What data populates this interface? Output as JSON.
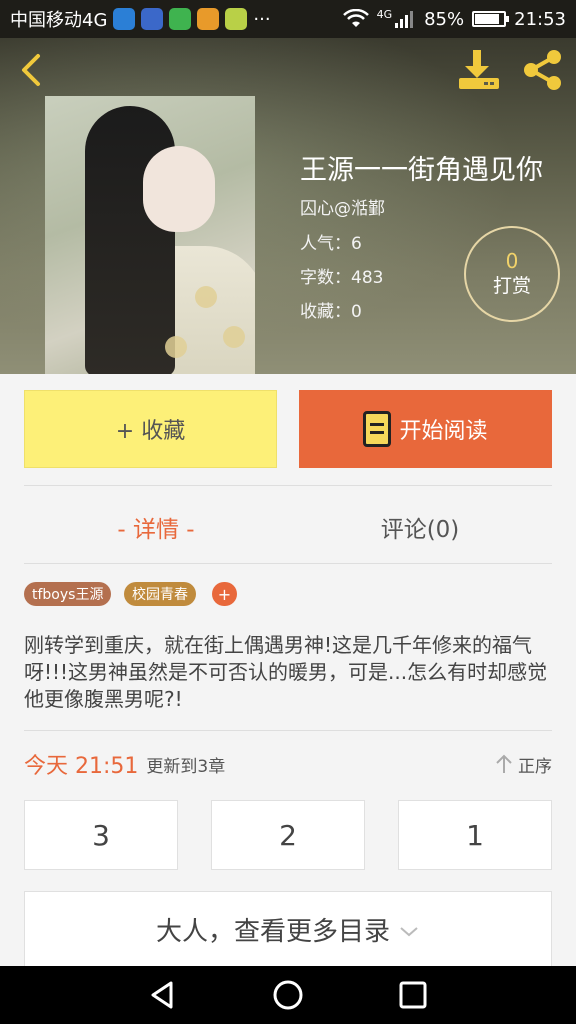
{
  "status_bar": {
    "carrier": "中国移动4G",
    "more": "···",
    "network": "4G",
    "battery": "85%",
    "battery_level": 0.85,
    "time": "21:53"
  },
  "header": {
    "title": "王源一一街角遇见你",
    "author": "囚心@湉鄞",
    "popularity": "人气：6",
    "word_count": "字数：483",
    "favorites": "收藏：0",
    "reward_count": "0",
    "reward_label": "打赏"
  },
  "actions": {
    "favorite_label": "+ 收藏",
    "read_label": "开始阅读"
  },
  "tabs": [
    {
      "label": "- 详情 -"
    },
    {
      "label": "评论(0)"
    }
  ],
  "tags": [
    "tfboys王源",
    "校园青春",
    "+"
  ],
  "description": "刚转学到重庆，就在街上偶遇男神!这是几千年修来的福气呀!!!这男神虽然是不可否认的暖男，可是...怎么有时却感觉他更像腹黑男呢?!",
  "update": {
    "time": "今天 21:51",
    "text": "更新到3章",
    "sort_label": "正序"
  },
  "chapters": [
    "3",
    "2",
    "1"
  ],
  "more_label": "大人，查看更多目录",
  "colors": {
    "accent": "#e8683b",
    "favorite_bg": "#fdf078",
    "status_bar": "#1e1d18"
  }
}
